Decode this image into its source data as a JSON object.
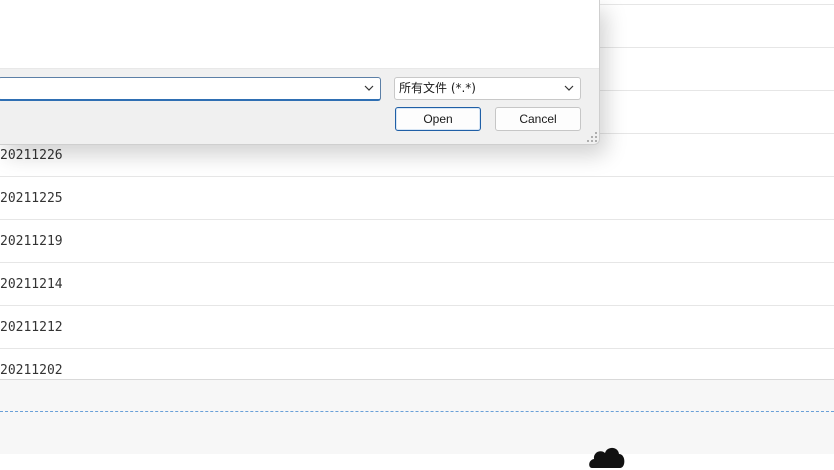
{
  "dialog": {
    "file_type": "所有文件 (*.*)",
    "open_label": "Open",
    "cancel_label": "Cancel"
  },
  "list": {
    "dates": [
      "20211226",
      "20211225",
      "20211219",
      "20211214",
      "20211212",
      "20211202"
    ]
  },
  "colors": {
    "accent": "#2f6fb3",
    "upload_border": "#6aa0d8"
  }
}
